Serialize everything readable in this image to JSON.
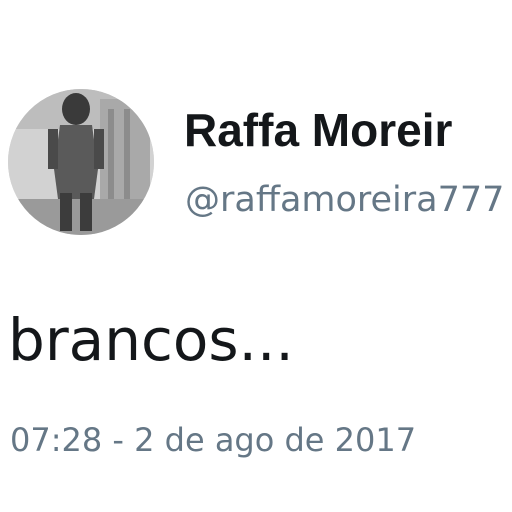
{
  "tweet": {
    "display_name": "Raffa Moreir",
    "handle": "@raffamoreira777",
    "text": "brancos...",
    "timestamp": "07:28 - 2 de ago de 2017"
  },
  "avatar": {
    "icon": "profile-photo",
    "bg_color": "#cfcfcf"
  },
  "colors": {
    "primary_text": "#14171a",
    "secondary_text": "#657786",
    "background": "#ffffff"
  }
}
